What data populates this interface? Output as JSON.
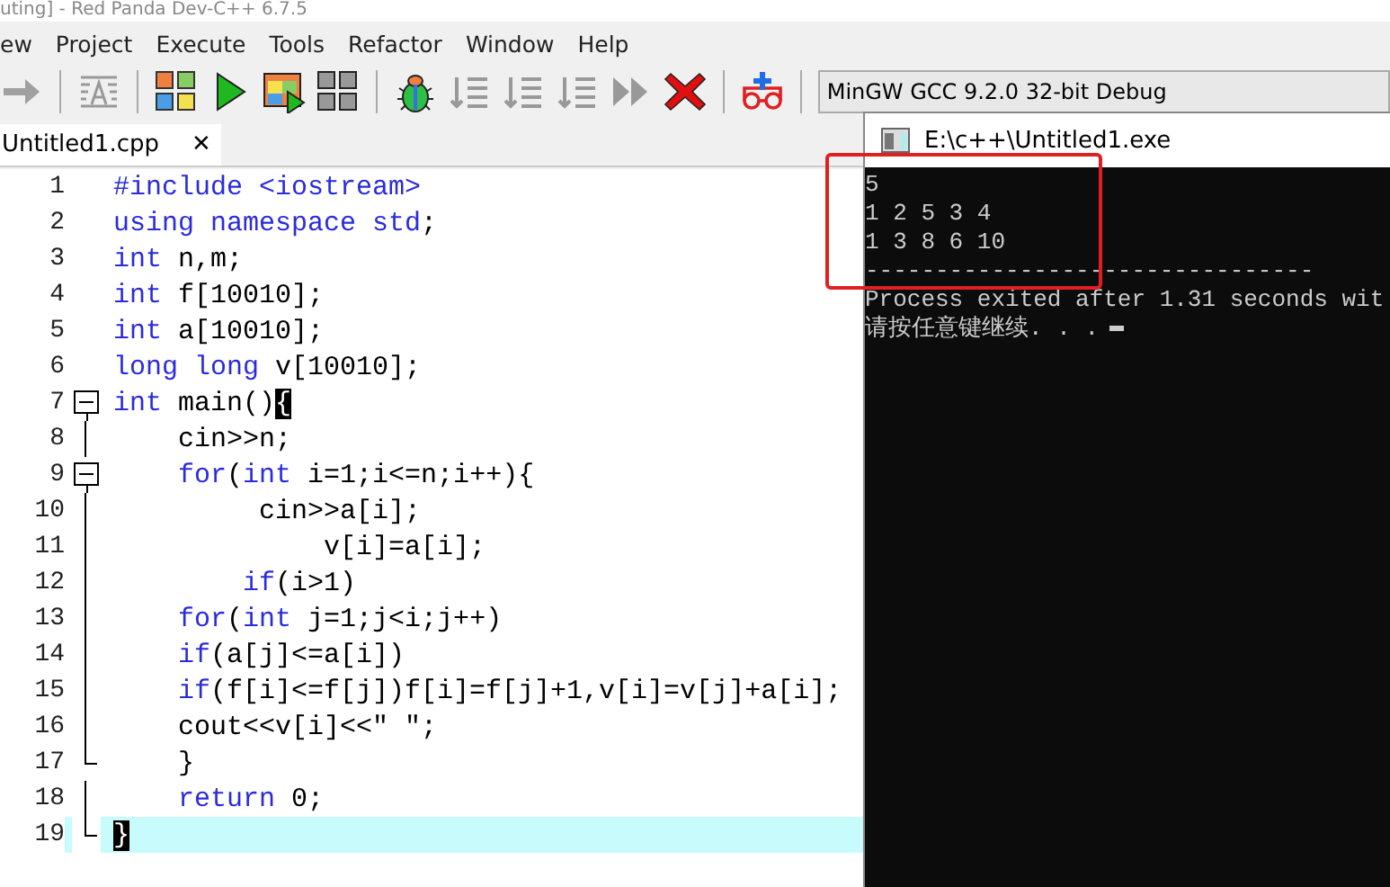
{
  "window": {
    "title": "uting] - Red Panda Dev-C++ 6.7.5"
  },
  "menu": [
    "ew",
    "Project",
    "Execute",
    "Tools",
    "Refactor",
    "Window",
    "Help"
  ],
  "toolbar": [
    {
      "kind": "arrow",
      "disabled": true
    },
    {
      "kind": "sep"
    },
    {
      "kind": "format",
      "disabled": true
    },
    {
      "kind": "sep"
    },
    {
      "kind": "compile",
      "disabled": false
    },
    {
      "kind": "run",
      "disabled": false
    },
    {
      "kind": "compile-run",
      "disabled": false
    },
    {
      "kind": "rebuild",
      "disabled": false
    },
    {
      "kind": "sep"
    },
    {
      "kind": "debug",
      "disabled": false
    },
    {
      "kind": "step",
      "disabled": true
    },
    {
      "kind": "step",
      "disabled": true
    },
    {
      "kind": "step",
      "disabled": true
    },
    {
      "kind": "continue",
      "disabled": true
    },
    {
      "kind": "stop",
      "disabled": false
    },
    {
      "kind": "sep"
    },
    {
      "kind": "watch",
      "disabled": false
    }
  ],
  "compiler": "MinGW GCC 9.2.0 32-bit Debug",
  "tabs": [
    {
      "label": "Untitled1.cpp",
      "selected": true,
      "close": "✕"
    }
  ],
  "editor": {
    "lines": [
      {
        "n": "1",
        "kind": "plain",
        "current": false,
        "segs": [
          {
            "t": "#include <iostream>",
            "kind": "keyword"
          }
        ]
      },
      {
        "n": "2",
        "kind": "plain",
        "current": false,
        "segs": [
          {
            "t": "using namespace std",
            "kind": "keyword"
          },
          {
            "t": ";",
            "kind": "text"
          }
        ]
      },
      {
        "n": "3",
        "kind": "plain",
        "current": false,
        "segs": [
          {
            "t": "int",
            "kind": "keyword"
          },
          {
            "t": " n,m;",
            "kind": "text"
          }
        ]
      },
      {
        "n": "4",
        "kind": "plain",
        "current": false,
        "segs": [
          {
            "t": "int",
            "kind": "keyword"
          },
          {
            "t": " f[10010];",
            "kind": "text"
          }
        ]
      },
      {
        "n": "5",
        "kind": "plain",
        "current": false,
        "segs": [
          {
            "t": "int",
            "kind": "keyword"
          },
          {
            "t": " a[10010];",
            "kind": "text"
          }
        ]
      },
      {
        "n": "6",
        "kind": "plain",
        "current": false,
        "segs": [
          {
            "t": "long long",
            "kind": "keyword"
          },
          {
            "t": " v[10010];",
            "kind": "text"
          }
        ]
      },
      {
        "n": "7",
        "kind": "fold-start",
        "current": false,
        "segs": [
          {
            "t": "int",
            "kind": "keyword"
          },
          {
            "t": " main()",
            "kind": "text"
          },
          {
            "t": "{",
            "kind": "brace"
          }
        ]
      },
      {
        "n": "8",
        "kind": "fold-body",
        "current": false,
        "segs": [
          {
            "t": "    cin>>n;",
            "kind": "text"
          }
        ]
      },
      {
        "n": "9",
        "kind": "fold-start",
        "current": false,
        "segs": [
          {
            "t": "    for",
            "kind": "keyword"
          },
          {
            "t": "(",
            "kind": "text"
          },
          {
            "t": "int",
            "kind": "keyword"
          },
          {
            "t": " i=1;i<=n;i++){",
            "kind": "text"
          }
        ]
      },
      {
        "n": "10",
        "kind": "fold-body",
        "current": false,
        "segs": [
          {
            "t": "         cin>>a[i];",
            "kind": "text"
          }
        ]
      },
      {
        "n": "11",
        "kind": "fold-body",
        "current": false,
        "segs": [
          {
            "t": "             v[i]=a[i];",
            "kind": "text"
          }
        ]
      },
      {
        "n": "12",
        "kind": "fold-body",
        "current": false,
        "segs": [
          {
            "t": "        if",
            "kind": "keyword"
          },
          {
            "t": "(i>1)",
            "kind": "text"
          }
        ]
      },
      {
        "n": "13",
        "kind": "fold-body",
        "current": false,
        "segs": [
          {
            "t": "    for",
            "kind": "keyword"
          },
          {
            "t": "(",
            "kind": "text"
          },
          {
            "t": "int",
            "kind": "keyword"
          },
          {
            "t": " j=1;j<i;j++)",
            "kind": "text"
          }
        ]
      },
      {
        "n": "14",
        "kind": "fold-body",
        "current": false,
        "segs": [
          {
            "t": "    if",
            "kind": "keyword"
          },
          {
            "t": "(a[j]<=a[i])",
            "kind": "text"
          }
        ]
      },
      {
        "n": "15",
        "kind": "fold-body",
        "current": false,
        "segs": [
          {
            "t": "    if",
            "kind": "keyword"
          },
          {
            "t": "(f[i]<=f[j])f[i]=f[j]+1,v[i]=v[j]+a[i];",
            "kind": "text"
          }
        ]
      },
      {
        "n": "16",
        "kind": "fold-body",
        "current": false,
        "segs": [
          {
            "t": "    cout<<v[i]<<\" \";",
            "kind": "text"
          }
        ]
      },
      {
        "n": "17",
        "kind": "fold-end",
        "current": false,
        "segs": [
          {
            "t": "    }",
            "kind": "text"
          }
        ]
      },
      {
        "n": "18",
        "kind": "fold-body",
        "current": false,
        "segs": [
          {
            "t": "    return",
            "kind": "keyword"
          },
          {
            "t": " 0;",
            "kind": "text"
          }
        ]
      },
      {
        "n": "19",
        "kind": "fold-end",
        "current": true,
        "segs": [
          {
            "t": "}",
            "kind": "brace"
          }
        ]
      }
    ]
  },
  "console": {
    "title": "E:\\c++\\Untitled1.exe",
    "lines": [
      "5",
      "1 2 5 3 4",
      "1 3 8 6 10",
      "--------------------------------",
      "Process exited after 1.31 seconds wit",
      "请按任意键继续. . ."
    ]
  }
}
